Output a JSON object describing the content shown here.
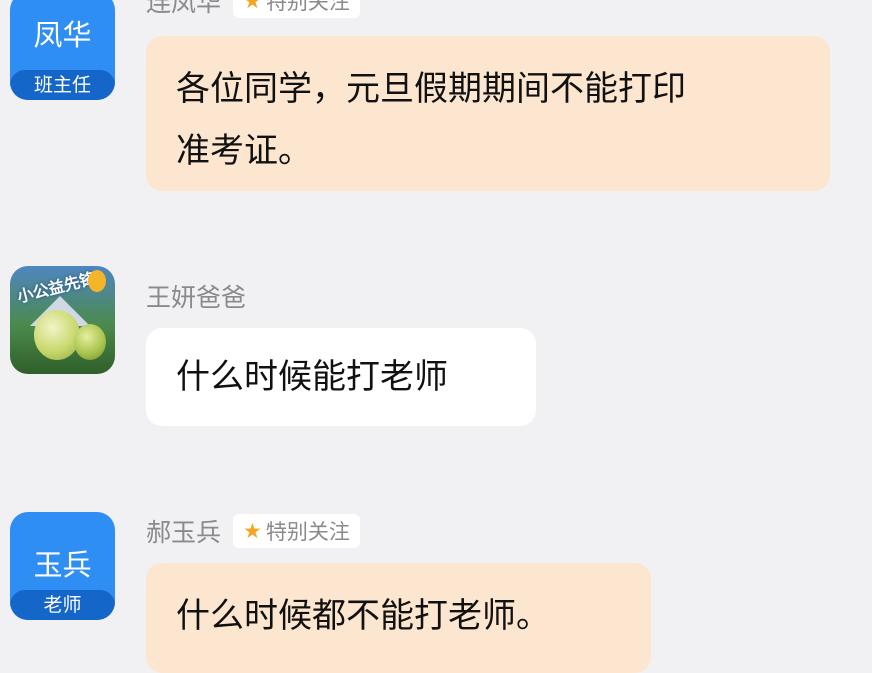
{
  "messages": [
    {
      "avatar_name": "凤华",
      "avatar_role": "班主任",
      "sender": "连凤华",
      "tag": "特别关注",
      "text_lines": [
        "各位同学，元旦假期期间不能打印",
        "准考证。"
      ]
    },
    {
      "avatar_text": "小公益先锋",
      "sender": "王妍爸爸",
      "text": "什么时候能打老师"
    },
    {
      "avatar_name": "玉兵",
      "avatar_role": "老师",
      "sender": "郝玉兵",
      "tag": "特别关注",
      "text": "什么时候都不能打老师。"
    }
  ],
  "icons": {
    "tag_icon": "star-icon",
    "accent_star": "#f4a623",
    "teacher_avatar": "#2f8ef3",
    "teacher_bubble": "#fce6cf"
  }
}
